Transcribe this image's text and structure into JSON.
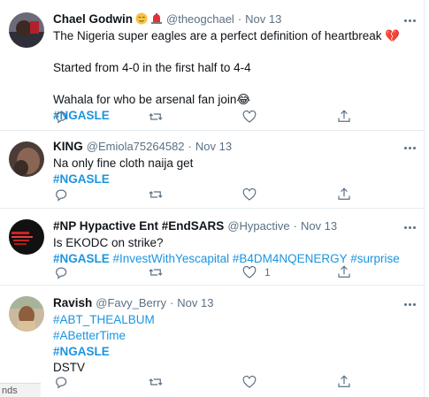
{
  "colors": {
    "link": "#1b95e0",
    "muted": "#5b7083",
    "text": "#0f1419",
    "divider": "#e6ecf0"
  },
  "tweets": [
    {
      "name": "Chael Godwin",
      "emojis": [
        "relieved-face-emoji",
        "police-light-emoji"
      ],
      "handle": "@theogchael",
      "time": "Nov 13",
      "lines": [
        "The Nigeria super eagles are a perfect definition of heartbreak 💔",
        "",
        "Started from 4-0 in the first half to 4-4",
        "",
        "Wahala for who be arsenal fan join😂"
      ],
      "hashtags": [
        "#NGASLE"
      ],
      "reply_count": "",
      "retweet_count": "",
      "like_count": ""
    },
    {
      "name": "KING",
      "handle": "@Emiola75264582",
      "time": "Nov 13",
      "lines": [
        "Na only fine cloth naija get"
      ],
      "hashtags": [
        "#NGASLE"
      ],
      "reply_count": "",
      "retweet_count": "",
      "like_count": ""
    },
    {
      "name": "#NP Hypactive Ent #EndSARS",
      "handle": "@Hypactive",
      "time": "Nov 13",
      "lines": [
        "Is EKODC on strike?"
      ],
      "tag_line": [
        "#NGASLE",
        "#InvestWithYescapital",
        "#B4DM4NQENERGY",
        "#surprise"
      ],
      "reply_count": "",
      "retweet_count": "",
      "like_count": "1"
    },
    {
      "name": "Ravish",
      "handle": "@Favy_Berry",
      "time": "Nov 13",
      "tags_top": [
        "#ABT_THEALBUM",
        "#ABetterTime"
      ],
      "hashtags": [
        "#NGASLE"
      ],
      "lines": [
        "DSTV"
      ],
      "reply_count": "",
      "retweet_count": "",
      "like_count": ""
    }
  ],
  "footer_fragment": "nds"
}
